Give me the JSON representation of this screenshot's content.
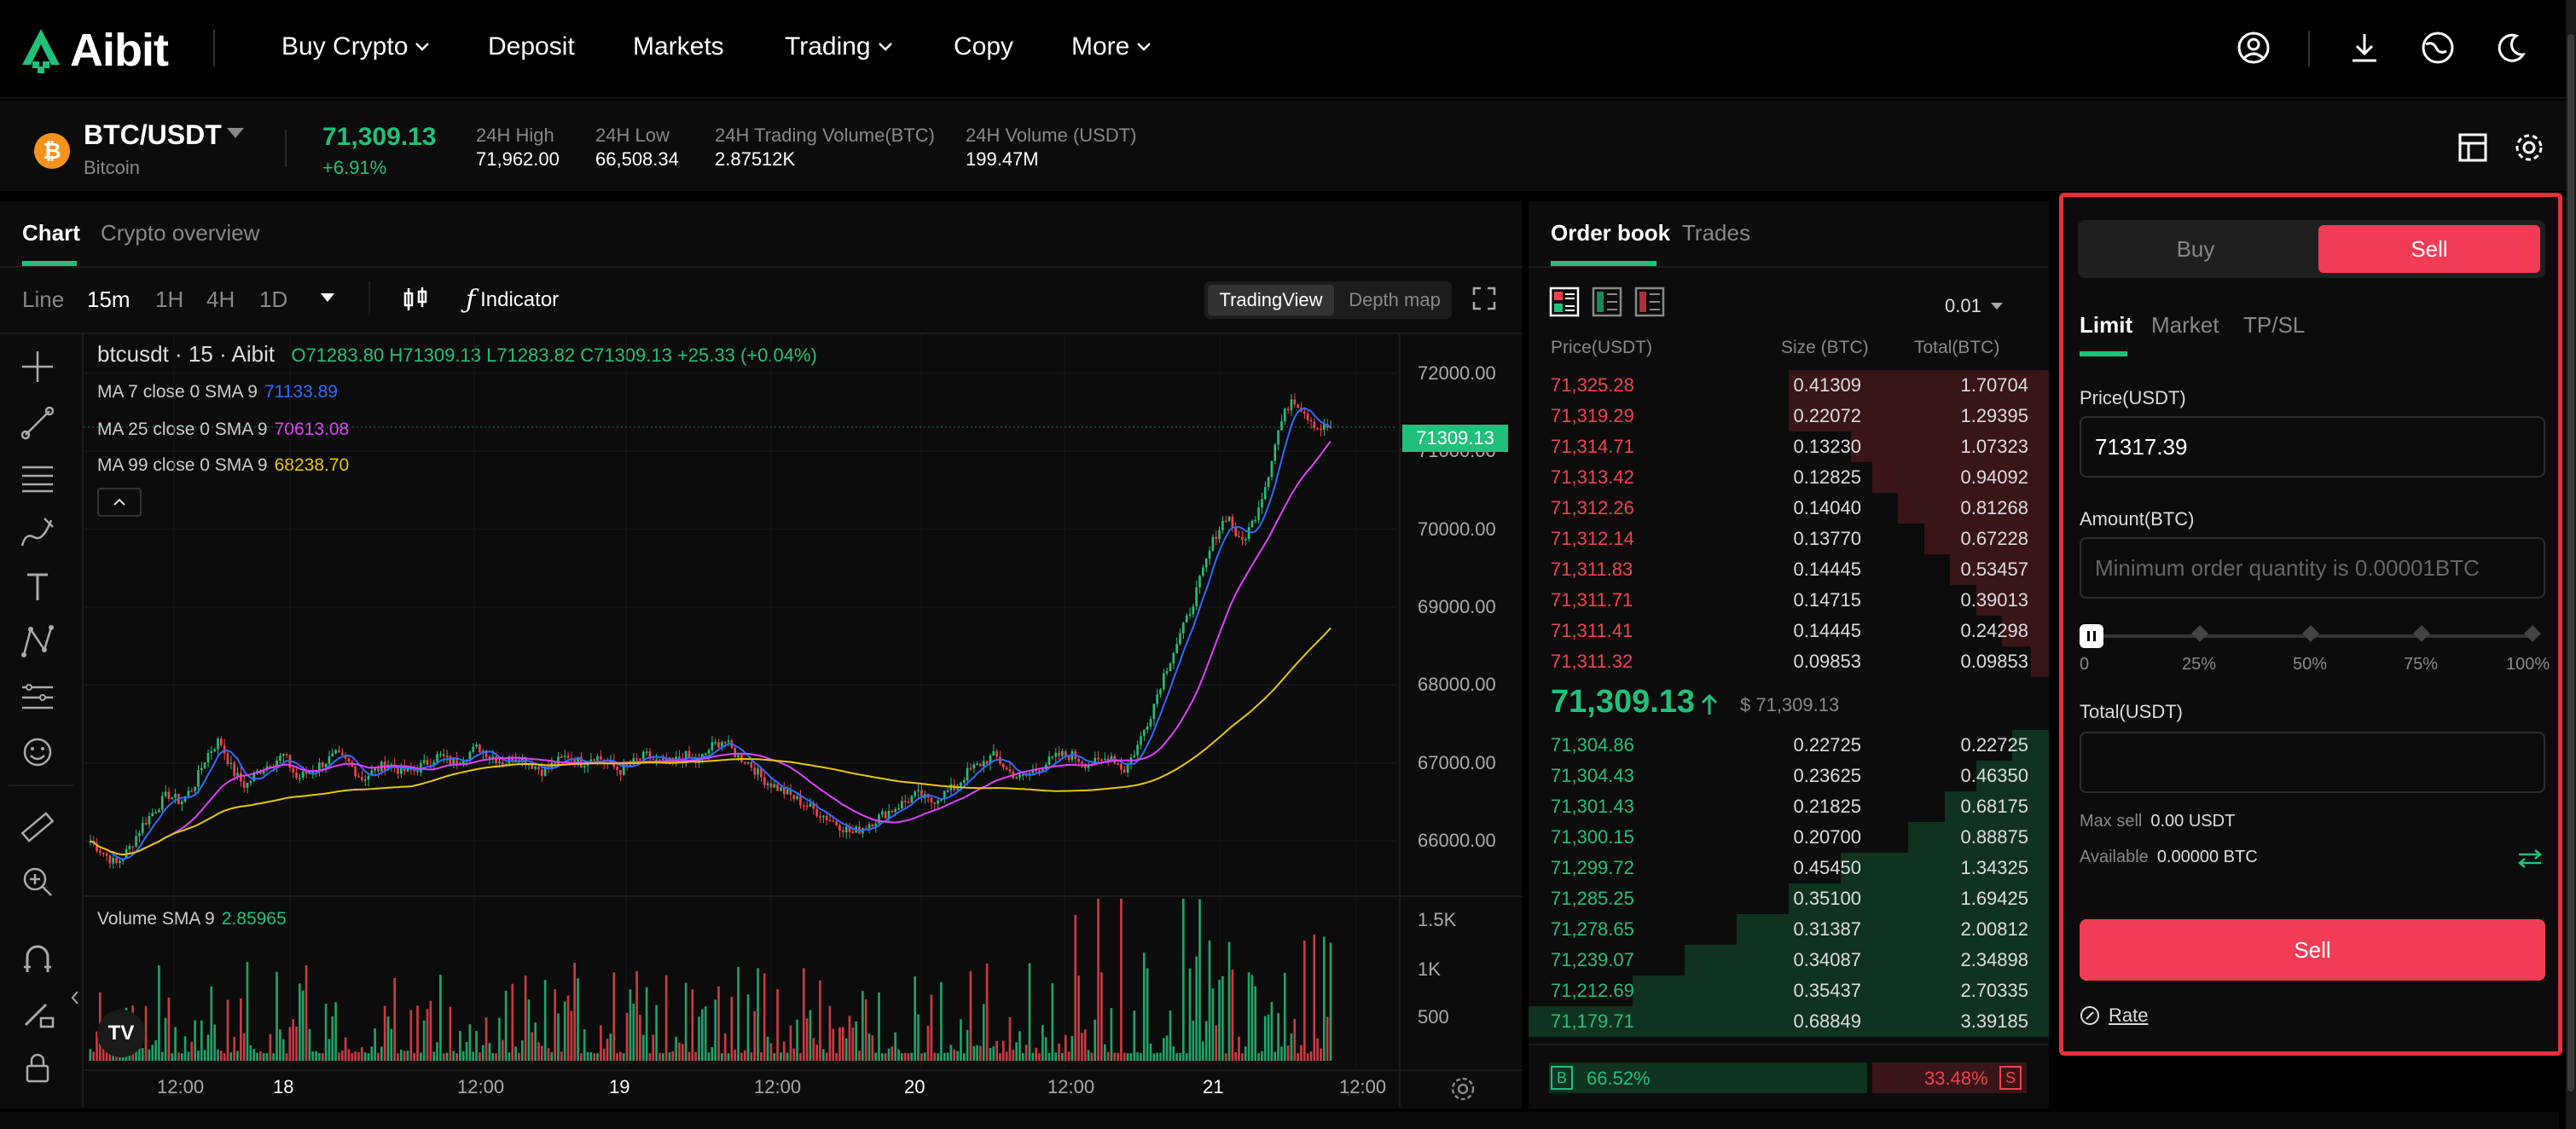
{
  "brand": {
    "name": "Aibit",
    "green": "#21c07a",
    "red": "#f23c56"
  },
  "nav": {
    "items": [
      "Buy Crypto",
      "Deposit",
      "Markets",
      "Trading",
      "Copy",
      "More"
    ]
  },
  "ticker": {
    "pair": "BTC/USDT",
    "name": "Bitcoin",
    "last": "71,309.13",
    "change": "+6.91%",
    "stats": [
      {
        "label": "24H High",
        "value": "71,962.00"
      },
      {
        "label": "24H Low",
        "value": "66,508.34"
      },
      {
        "label": "24H Trading Volume(BTC)",
        "value": "2.87512K"
      },
      {
        "label": "24H Volume (USDT)",
        "value": "199.47M"
      }
    ]
  },
  "chart_tabs": [
    "Chart",
    "Crypto overview"
  ],
  "timeframes": [
    "Line",
    "15m",
    "1H",
    "4H",
    "1D"
  ],
  "indicator_label": "Indicator",
  "views": [
    "TradingView",
    "Depth map"
  ],
  "legend": {
    "symbol": "btcusdt",
    "interval": "15",
    "source": "Aibit",
    "ohlc": "O71283.80 H71309.13 L71283.82 C71309.13 +25.33 (+0.04%)",
    "ma7": {
      "label": "MA 7 close 0 SMA 9",
      "value": "71133.89",
      "color": "#2f6bff"
    },
    "ma25": {
      "label": "MA 25 close 0 SMA 9",
      "value": "70613.08",
      "color": "#e040fb"
    },
    "ma99": {
      "label": "MA 99 close 0 SMA 9",
      "value": "68238.70",
      "color": "#e6c700"
    },
    "volume": {
      "label": "Volume SMA 9",
      "value": "2.85965"
    }
  },
  "chart_data": {
    "type": "candlestick",
    "y_ticks": [
      "72000.00",
      "71000.00",
      "70000.00",
      "69000.00",
      "68000.00",
      "67000.00",
      "66000.00"
    ],
    "ylim": [
      65500,
      72500
    ],
    "vol_ticks": [
      "1.5K",
      "1K",
      "500"
    ],
    "x_ticks": [
      "12:00",
      "18",
      "12:00",
      "19",
      "12:00",
      "20",
      "12:00",
      "21",
      "12:00"
    ],
    "last_price_tag": "71309.13",
    "close_path": [
      66000,
      65850,
      65700,
      65900,
      66200,
      66400,
      66600,
      66500,
      66700,
      67100,
      67300,
      66900,
      66700,
      66900,
      67000,
      67100,
      66800,
      66900,
      67000,
      67100,
      67000,
      66800,
      66900,
      67000,
      66900,
      66900,
      67000,
      67100,
      67000,
      67100,
      67200,
      67100,
      67000,
      67100,
      67000,
      66900,
      67000,
      67100,
      67000,
      67100,
      67000,
      66900,
      67000,
      67100,
      67000,
      67000,
      67100,
      67000,
      67200,
      67300,
      67100,
      67000,
      66800,
      66700,
      66600,
      66500,
      66400,
      66300,
      66200,
      66100,
      66200,
      66300,
      66400,
      66500,
      66600,
      66500,
      66600,
      66700,
      66900,
      67000,
      67100,
      66900,
      66800,
      66900,
      67000,
      67100,
      67100,
      67000,
      67000,
      67100,
      66900,
      67200,
      67600,
      68100,
      68500,
      68900,
      69400,
      69900,
      70200,
      69800,
      70100,
      70600,
      71300,
      71700,
      71500,
      71300,
      71309
    ]
  },
  "orderbook": {
    "tabs": [
      "Order book",
      "Trades"
    ],
    "precision": "0.01",
    "headers": [
      "Price(USDT)",
      "Size (BTC)",
      "Total(BTC)"
    ],
    "asks": [
      {
        "price": "71,325.28",
        "size": "0.41309",
        "total": "1.70704",
        "depth": 0.5
      },
      {
        "price": "71,319.29",
        "size": "0.22072",
        "total": "1.29395",
        "depth": 0.5
      },
      {
        "price": "71,314.71",
        "size": "0.13230",
        "total": "1.07323",
        "depth": 0.38
      },
      {
        "price": "71,313.42",
        "size": "0.12825",
        "total": "0.94092",
        "depth": 0.34
      },
      {
        "price": "71,312.26",
        "size": "0.14040",
        "total": "0.81268",
        "depth": 0.29
      },
      {
        "price": "71,312.14",
        "size": "0.13770",
        "total": "0.67228",
        "depth": 0.24
      },
      {
        "price": "71,311.83",
        "size": "0.14445",
        "total": "0.53457",
        "depth": 0.19
      },
      {
        "price": "71,311.71",
        "size": "0.14715",
        "total": "0.39013",
        "depth": 0.14
      },
      {
        "price": "71,311.41",
        "size": "0.14445",
        "total": "0.24298",
        "depth": 0.09
      },
      {
        "price": "71,311.32",
        "size": "0.09853",
        "total": "0.09853",
        "depth": 0.035
      }
    ],
    "mid": {
      "price": "71,309.13",
      "usd": "$ 71,309.13"
    },
    "bids": [
      {
        "price": "71,304.86",
        "size": "0.22725",
        "total": "0.22725",
        "depth": 0.07
      },
      {
        "price": "71,304.43",
        "size": "0.23625",
        "total": "0.46350",
        "depth": 0.14
      },
      {
        "price": "71,301.43",
        "size": "0.21825",
        "total": "0.68175",
        "depth": 0.2
      },
      {
        "price": "71,300.15",
        "size": "0.20700",
        "total": "0.88875",
        "depth": 0.27
      },
      {
        "price": "71,299.72",
        "size": "0.45450",
        "total": "1.34325",
        "depth": 0.4
      },
      {
        "price": "71,285.25",
        "size": "0.35100",
        "total": "1.69425",
        "depth": 0.5
      },
      {
        "price": "71,278.65",
        "size": "0.31387",
        "total": "2.00812",
        "depth": 0.6
      },
      {
        "price": "71,239.07",
        "size": "0.34087",
        "total": "2.34898",
        "depth": 0.7
      },
      {
        "price": "71,212.69",
        "size": "0.35437",
        "total": "2.70335",
        "depth": 0.8
      },
      {
        "price": "71,179.71",
        "size": "0.68849",
        "total": "3.39185",
        "depth": 1.0
      }
    ],
    "buy_ratio": "66.52%",
    "sell_ratio": "33.48%",
    "buy_fraction": 0.6652,
    "b_label": "B",
    "s_label": "S"
  },
  "trade": {
    "buy_label": "Buy",
    "sell_label": "Sell",
    "order_types": [
      "Limit",
      "Market",
      "TP/SL"
    ],
    "price_label": "Price(USDT)",
    "price_value": "71317.39",
    "amount_label": "Amount(BTC)",
    "amount_placeholder": "Minimum order quantity is 0.00001BTC",
    "slider_marks": [
      "0",
      "25%",
      "50%",
      "75%",
      "100%"
    ],
    "total_label": "Total(USDT)",
    "max_sell_label": "Max sell",
    "max_sell_value": "0.00 USDT",
    "available_label": "Available",
    "available_value": "0.00000 BTC",
    "submit_label": "Sell",
    "rate_label": "Rate"
  }
}
